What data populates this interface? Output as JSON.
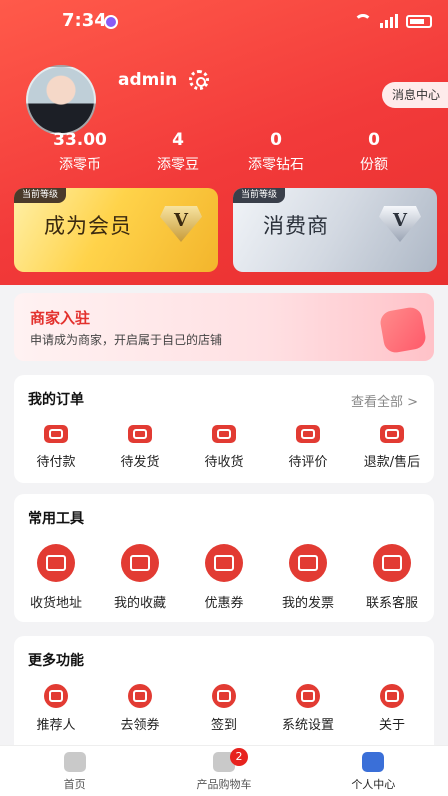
{
  "status_bar": {
    "time": "7:34"
  },
  "profile": {
    "username": "admin",
    "message_center": "消息中心",
    "stats": [
      {
        "value": "33.00",
        "label": "添零币"
      },
      {
        "value": "4",
        "label": "添零豆"
      },
      {
        "value": "0",
        "label": "添零钻石"
      },
      {
        "value": "0",
        "label": "份额"
      }
    ]
  },
  "levels": [
    {
      "tag": "当前等级",
      "name": "成为会员",
      "badge": "V"
    },
    {
      "tag": "当前等级",
      "name": "消费商",
      "badge": "V"
    }
  ],
  "merchant": {
    "title": "商家入驻",
    "subtitle": "申请成为商家，开启属于自己的店铺"
  },
  "orders": {
    "title": "我的订单",
    "see_all": "查看全部 >",
    "items": [
      "待付款",
      "待发货",
      "待收货",
      "待评价",
      "退款/售后"
    ]
  },
  "tools": {
    "title": "常用工具",
    "items": [
      "收货地址",
      "我的收藏",
      "优惠券",
      "我的发票",
      "联系客服"
    ]
  },
  "more": {
    "title": "更多功能",
    "items": [
      "推荐人",
      "去领券",
      "签到",
      "系统设置",
      "关于"
    ]
  },
  "tabbar": {
    "items": [
      {
        "label": "首页"
      },
      {
        "label": "产品购物车",
        "badge": "2"
      },
      {
        "label": "个人中心"
      }
    ]
  },
  "colors": {
    "primary": "#e23b33",
    "hero_start": "#ff5a4a",
    "hero_end": "#e9302f",
    "active_tab": "#3a6fd8"
  }
}
